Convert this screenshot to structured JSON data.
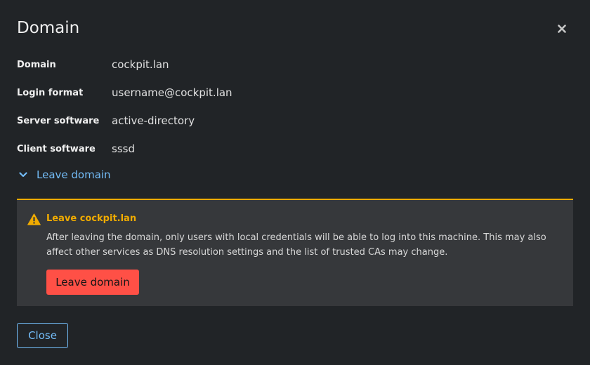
{
  "modal": {
    "title": "Domain"
  },
  "details": [
    {
      "label": "Domain",
      "value": "cockpit.lan"
    },
    {
      "label": "Login format",
      "value": "username@cockpit.lan"
    },
    {
      "label": "Server software",
      "value": "active-directory"
    },
    {
      "label": "Client software",
      "value": "sssd"
    }
  ],
  "leave_toggle": {
    "label": "Leave domain",
    "expanded": true,
    "icon": "chevron-down-icon"
  },
  "alert": {
    "title": "Leave cockpit.lan",
    "icon": "warning-triangle-icon",
    "body": "After leaving the domain, only users with local credentials will be able to log into this machine. This may also affect other services as DNS resolution settings and the list of trusted CAs may change.",
    "button_label": "Leave domain"
  },
  "footer": {
    "close_label": "Close"
  },
  "colors": {
    "background": "#212427",
    "link": "#73bcf7",
    "warning": "#f0ab00",
    "danger": "#ff5046",
    "alert_bg": "#36383b"
  }
}
